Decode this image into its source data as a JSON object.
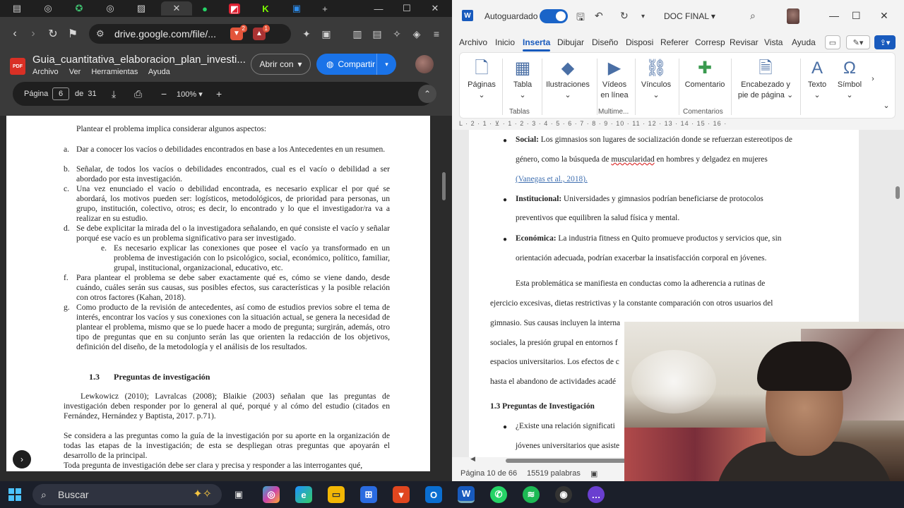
{
  "chrome": {
    "tabs": [
      "▤",
      "◎",
      "✪",
      "◎",
      "▨",
      "✕",
      "●",
      "◩",
      "K",
      "▣"
    ],
    "new_tab": "+",
    "window_controls": [
      "—",
      "☐",
      "✕"
    ],
    "url": "drive.google.com/file/...",
    "extension_badge": "2",
    "extension_badge2": "1"
  },
  "pdf": {
    "file_badge": "PDF",
    "title": "Guia_cuantitativa_elaboracion_plan_investi...",
    "menu": [
      "Archivo",
      "Ver",
      "Herramientas",
      "Ayuda"
    ],
    "open_with": "Abrir con",
    "share": "Compartir",
    "page_label": "Página",
    "page_current": "6",
    "page_of": "de",
    "page_total": "31",
    "zoom": "100%",
    "content": {
      "intro": "Plantear el problema implica considerar algunos aspectos:",
      "items": [
        {
          "label": "a.",
          "text": "Dar a conocer los vacíos o debilidades encontrados en base a los Antecedentes en un resumen."
        },
        {
          "label": "b.",
          "text": "Señalar, de todos los vacíos o debilidades encontrados, cual es el vacío o debilidad a ser abordado por esta investigación."
        },
        {
          "label": "c.",
          "text": "Una vez enunciado el vacío o debilidad encontrada, es necesario explicar el por qué se abordará, los motivos pueden ser: logísticos, metodológicos, de prioridad para personas, un grupo, institución, colectivo, otros; es decir, lo encontrado y lo que el investigador/ra va a realizar en su estudio."
        },
        {
          "label": "d.",
          "text": "Se debe explicitar la mirada del o la investigadora señalando, en qué consiste el vacío y señalar porqué ese vacío es un problema significativo para ser investigado."
        },
        {
          "label": "e.",
          "text": "Es necesario explicar las conexiones que posee el vacío ya transformado en un problema de investigación con lo psicológico, social, económico, político, familiar, grupal, institucional, organizacional, educativo, etc."
        },
        {
          "label": "f.",
          "text": "Para plantear el problema se debe saber exactamente qué es, cómo se viene dando, desde cuándo, cuáles serán sus causas, sus posibles efectos, sus características y la posible relación con otros factores (Kahan, 2018)."
        },
        {
          "label": "g.",
          "text": "Como producto de la revisión de antecedentes, así como de estudios previos sobre el tema de interés, encontrar los vacíos y sus conexiones con la situación actual, se genera la necesidad de plantear el problema, mismo que se lo puede hacer a modo de pregunta; surgirán, además, otro tipo de preguntas que en su conjunto serán las que orienten la redacción de los objetivos, definición del diseño, de la metodología y el análisis de los resultados."
        }
      ],
      "section_num": "1.3",
      "section_title": "Preguntas de investigación",
      "p1": "Lewkowicz (2010); Lavralcas (2008); Blaikie (2003) señalan que las preguntas de investigación deben responder por lo general al qué, porqué y al cómo del estudio (citados en Fernández, Hernández y Baptista, 2017. p.71).",
      "p2": "Se considera a las preguntas como la guía de la investigación por su aporte en la organización de todas las etapas de la investigación; de esta se despliegan otras preguntas que apoyarán el desarrollo de la principal.",
      "p3": "Toda pregunta de investigación debe ser clara y precisa y responder a las interrogantes qué,"
    }
  },
  "word": {
    "logo": "W",
    "autosave": "Autoguardado",
    "doc_name": "DOC FINAL",
    "menu": [
      "Archivo",
      "Inicio",
      "Inserta",
      "Dibujar",
      "Diseño",
      "Disposi",
      "Referer",
      "Corresp",
      "Revisar",
      "Vista",
      "Ayuda"
    ],
    "ribbon": {
      "paginas": "Páginas",
      "tabla": "Tabla",
      "ilustraciones": "Ilustraciones",
      "videos_l1": "Vídeos",
      "videos_l2": "en línea",
      "vinculos": "Vínculos",
      "comentario": "Comentario",
      "encabezado_l1": "Encabezado y",
      "encabezado_l2": "pie de página",
      "texto": "Texto",
      "simbolos": "Símbol",
      "grp_tablas": "Tablas",
      "grp_multimedia": "Multime...",
      "grp_comentarios": "Comentarios"
    },
    "ruler": "L · 2 · 1 · ⊻ · 1 · 2 · 3 · 4 · 5 · 6 · 7 · 8 · 9 · 10 · 11 · 12 · 13 · 14 · 15 · 16 ·",
    "body": {
      "social_label": "Social:",
      "social_l1": " Los gimnasios son lugares de socialización donde se refuerzan estereotipos de",
      "social_l2a": "género, como la búsqueda de ",
      "social_l2b": "muscularidad",
      "social_l2c": " en hombres y delgadez en mujeres",
      "social_cite": "(Vanegas et al., 2018).",
      "inst_label": "Institucional:",
      "inst_l1": " Universidades y gimnasios podrían beneficiarse de protocolos",
      "inst_l2": "preventivos que equilibren la salud física y mental.",
      "econ_label": "Económica:",
      "econ_l1": " La industria fitness en Quito promueve productos y servicios que, sin",
      "econ_l2": "orientación adecuada, podrían exacerbar la insatisfacción corporal en jóvenes.",
      "para_l1": "Esta problemática se manifiesta en conductas como la adherencia a rutinas de",
      "para_l2": "ejercicio excesivas, dietas restrictivas y la constante comparación con otros usuarios del",
      "para_l3": "gimnasio. Sus causas incluyen la interna",
      "para_l4": "sociales, la presión grupal en entornos f",
      "para_l5": "espacios universitarios. Los efectos de c",
      "para_l6": "hasta el abandono de actividades acadé",
      "sec_heading": "1.3  Preguntas de Investigación",
      "q1_l1": "¿Existe una relación significati",
      "q1_l2": "jóvenes universitarios que asiste"
    },
    "status_page": "Página 10 de 66",
    "status_words": "15519 palabras"
  },
  "taskbar": {
    "search_placeholder": "Buscar"
  }
}
